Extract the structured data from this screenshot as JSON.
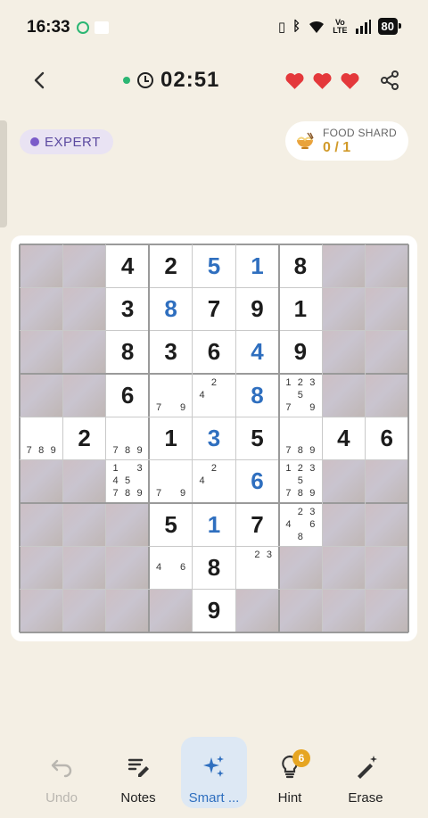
{
  "status_bar": {
    "time": "16:33",
    "network": "Vo\nLTE",
    "battery": "80"
  },
  "header": {
    "timer": "02:51",
    "timer_dot_color": "#2bb673",
    "lives": 3,
    "heart_color": "#e4383b"
  },
  "level": {
    "label": "EXPERT"
  },
  "food_shard": {
    "label": "FOOD SHARD",
    "count": "0 / 1"
  },
  "board": {
    "rows": [
      [
        {
          "s": "locked"
        },
        {
          "s": "locked"
        },
        {
          "v": "4",
          "k": "given"
        },
        {
          "v": "2",
          "k": "given"
        },
        {
          "v": "5",
          "k": "user"
        },
        {
          "v": "1",
          "k": "user"
        },
        {
          "v": "8",
          "k": "given"
        },
        {
          "s": "locked"
        },
        {
          "s": "locked"
        }
      ],
      [
        {
          "s": "locked"
        },
        {
          "s": "locked"
        },
        {
          "v": "3",
          "k": "given"
        },
        {
          "v": "8",
          "k": "user"
        },
        {
          "v": "7",
          "k": "given"
        },
        {
          "v": "9",
          "k": "given"
        },
        {
          "v": "1",
          "k": "given"
        },
        {
          "s": "locked"
        },
        {
          "s": "locked"
        }
      ],
      [
        {
          "s": "locked"
        },
        {
          "s": "locked"
        },
        {
          "v": "8",
          "k": "given"
        },
        {
          "v": "3",
          "k": "given"
        },
        {
          "v": "6",
          "k": "given"
        },
        {
          "v": "4",
          "k": "user"
        },
        {
          "v": "9",
          "k": "given"
        },
        {
          "s": "locked"
        },
        {
          "s": "locked"
        }
      ],
      [
        {
          "s": "locked"
        },
        {
          "s": "locked"
        },
        {
          "v": "6",
          "k": "given"
        },
        {
          "notes": [
            "",
            "",
            "",
            "",
            "",
            "",
            "7",
            "",
            "9"
          ]
        },
        {
          "notes": [
            "",
            "2",
            "",
            "4",
            "",
            "",
            "",
            "",
            ""
          ]
        },
        {
          "v": "8",
          "k": "user"
        },
        {
          "notes": [
            "1",
            "2",
            "3",
            "",
            "5",
            "",
            "7",
            "",
            "9"
          ]
        },
        {
          "s": "locked"
        },
        {
          "s": "locked"
        }
      ],
      [
        {
          "notes": [
            "",
            "",
            "",
            "",
            "",
            "",
            "7",
            "8",
            "9"
          ]
        },
        {
          "v": "2",
          "k": "given"
        },
        {
          "notes": [
            "",
            "",
            "",
            "",
            "",
            "",
            "7",
            "8",
            "9"
          ]
        },
        {
          "v": "1",
          "k": "given"
        },
        {
          "v": "3",
          "k": "user"
        },
        {
          "v": "5",
          "k": "given"
        },
        {
          "notes": [
            "",
            "",
            "",
            "",
            "",
            "",
            "7",
            "8",
            "9"
          ]
        },
        {
          "v": "4",
          "k": "given"
        },
        {
          "v": "6",
          "k": "given"
        }
      ],
      [
        {
          "s": "locked"
        },
        {
          "s": "locked"
        },
        {
          "notes": [
            "1",
            "",
            "3",
            "4",
            "5",
            "",
            "7",
            "8",
            "9"
          ]
        },
        {
          "notes": [
            "",
            "",
            "",
            "",
            "",
            "",
            "7",
            "",
            "9"
          ]
        },
        {
          "notes": [
            "",
            "2",
            "",
            "4",
            "",
            "",
            "",
            "",
            ""
          ]
        },
        {
          "v": "6",
          "k": "user"
        },
        {
          "notes": [
            "1",
            "2",
            "3",
            "",
            "5",
            "",
            "7",
            "8",
            "9"
          ]
        },
        {
          "s": "locked"
        },
        {
          "s": "locked"
        }
      ],
      [
        {
          "s": "locked"
        },
        {
          "s": "locked"
        },
        {
          "s": "locked"
        },
        {
          "v": "5",
          "k": "given"
        },
        {
          "v": "1",
          "k": "user"
        },
        {
          "v": "7",
          "k": "given"
        },
        {
          "notes": [
            "",
            "2",
            "3",
            "4",
            "",
            "6",
            "",
            "8",
            ""
          ]
        },
        {
          "s": "locked"
        },
        {
          "s": "locked"
        }
      ],
      [
        {
          "s": "locked"
        },
        {
          "s": "locked"
        },
        {
          "s": "locked"
        },
        {
          "notes": [
            "",
            "",
            "",
            "4",
            "",
            "6",
            "",
            "",
            ""
          ]
        },
        {
          "v": "8",
          "k": "given"
        },
        {
          "notes": [
            "",
            "2",
            "3",
            "",
            "",
            "",
            "",
            "",
            ""
          ]
        },
        {
          "s": "locked"
        },
        {
          "s": "locked"
        },
        {
          "s": "locked"
        }
      ],
      [
        {
          "s": "locked"
        },
        {
          "s": "locked"
        },
        {
          "s": "locked"
        },
        {
          "s": "locked"
        },
        {
          "v": "9",
          "k": "given"
        },
        {
          "s": "locked"
        },
        {
          "s": "locked"
        },
        {
          "s": "locked"
        },
        {
          "s": "locked"
        }
      ]
    ]
  },
  "toolbar": {
    "undo_label": "Undo",
    "notes_label": "Notes",
    "smart_label": "Smart ...",
    "hint_label": "Hint",
    "hint_count": "6",
    "erase_label": "Erase"
  },
  "colors": {
    "background": "#f4efe4",
    "user_digit": "#2f6fbf",
    "accent": "#2f6fbf",
    "level": "#7b5cc9",
    "shard": "#d19a2a"
  }
}
